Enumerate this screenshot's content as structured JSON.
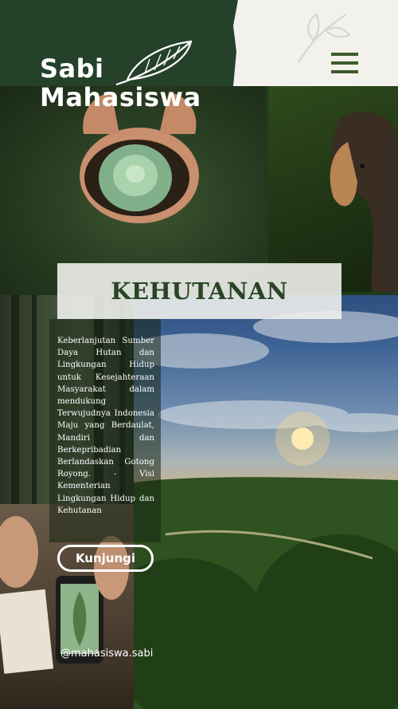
{
  "brand": {
    "line1": "Sabi",
    "line2": "Mahasiswa",
    "logo_icon": "leaf-icon"
  },
  "menu": {
    "icon": "hamburger-menu-icon"
  },
  "section": {
    "title": "KEHUTANAN",
    "description": "Keberlanjutan Sumber Daya Hutan dan Lingkungan Hidup untuk Kesejahteraan Masyarakat dalam mendukung Terwujudnya Indonesia Maju yang Berdaulat, Mandiri dan Berkepribadian Berlandaskan Gotong Royong. - Visi Kementerian Lingkungan Hidup dan Kehutanan"
  },
  "cta": {
    "label": "Kunjungi"
  },
  "social": {
    "handle": "@mahasiswa.sabi"
  },
  "colors": {
    "header_green": "#25412a",
    "paper": "#f2f1ec",
    "title_text": "#2a4426",
    "menu_icon": "#3c5a2a"
  }
}
